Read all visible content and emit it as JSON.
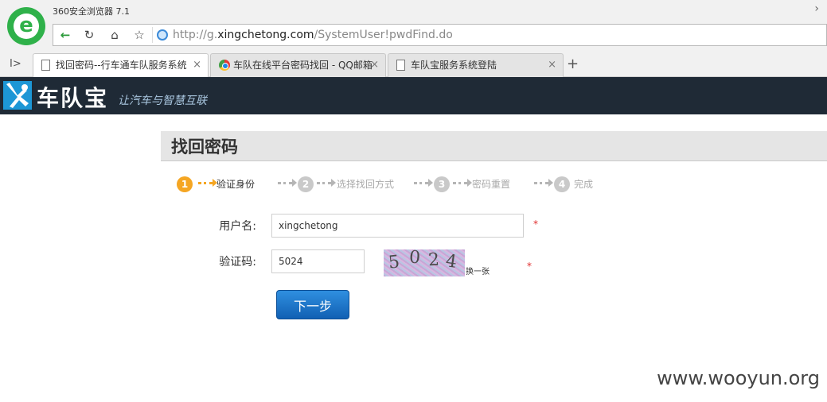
{
  "browser": {
    "app_title": "360安全浏览器 7.1",
    "url_prefix": "http://g.",
    "url_host": "xingchetong.com",
    "url_path": "/SystemUser!pwdFind.do",
    "tabs": [
      {
        "label": "找回密码--行车通车队服务系统",
        "active": true,
        "icon": "page-icon"
      },
      {
        "label": "车队在线平台密码找回 - QQ邮箱",
        "active": false,
        "icon": "chrome-icon"
      },
      {
        "label": "车队宝服务系统登陆",
        "active": false,
        "icon": "page-icon"
      }
    ],
    "close_glyph": "×",
    "new_tab_glyph": "+"
  },
  "site": {
    "brand_name": "车队宝",
    "slogan": "让汽车与智慧互联",
    "brand_color": "#1d97d6",
    "header_bg": "#1f2a36"
  },
  "page": {
    "title": "找回密码",
    "steps": [
      {
        "num": "1",
        "label": "验证身份",
        "current": true
      },
      {
        "num": "2",
        "label": "选择找回方式",
        "current": false
      },
      {
        "num": "3",
        "label": "密码重置",
        "current": false
      },
      {
        "num": "4",
        "label": "完成",
        "current": false
      }
    ],
    "form": {
      "username_label": "用户名:",
      "username_value": "xingchetong",
      "captcha_label": "验证码:",
      "captcha_value": "5024",
      "captcha_image_text": [
        "5",
        "0",
        "2",
        "4"
      ],
      "refresh_link": "换一张",
      "required_mark": "*",
      "submit_label": "下一步"
    }
  },
  "watermark": "www.wooyun.org"
}
